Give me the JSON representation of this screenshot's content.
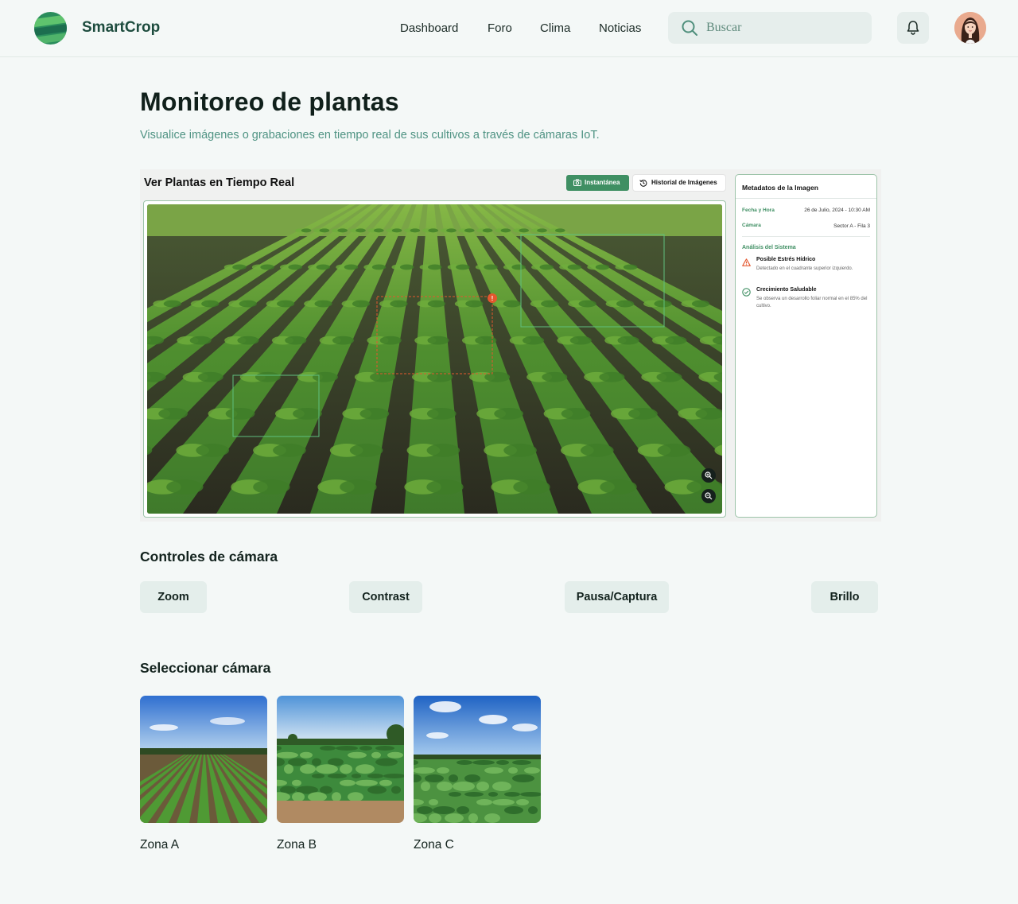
{
  "app": {
    "name": "SmartCrop"
  },
  "nav": {
    "items": [
      {
        "label": "Dashboard"
      },
      {
        "label": "Foro"
      },
      {
        "label": "Clima"
      },
      {
        "label": "Noticias"
      }
    ]
  },
  "search": {
    "placeholder": "Buscar"
  },
  "page": {
    "title": "Monitoreo de plantas",
    "subtitle": "Visualice imágenes o grabaciones en tiempo real de sus cultivos a través de cámaras IoT."
  },
  "monitor": {
    "title": "Ver Plantas en Tiempo Real",
    "snapshot_label": "Instantánea",
    "history_label": "Historial de Imágenes",
    "marker_label": "!"
  },
  "metadata": {
    "title": "Metadatos de la Imagen",
    "fields": [
      {
        "key": "Fecha y Hora",
        "value": "26 de Julio, 2024 - 10:30 AM"
      },
      {
        "key": "Cámara",
        "value": "Sector A - Fila 3"
      }
    ],
    "analysis_title": "Análisis del Sistema",
    "alerts": [
      {
        "title": "Posible Estrés Hídrico",
        "detail": "Detectado en el cuadrante superior izquierdo.",
        "icon": "warning-icon",
        "color": "#e4572e"
      },
      {
        "title": "Crecimiento Saludable",
        "detail": "Se observa un desarrollo foliar normal en el 85% del cultivo.",
        "icon": "check-circle-icon",
        "color": "#3f8f63"
      }
    ]
  },
  "controls": {
    "title": "Controles de cámara",
    "buttons": [
      {
        "label": "Zoom"
      },
      {
        "label": "Contrast"
      },
      {
        "label": "Pausa/Captura"
      },
      {
        "label": "Brillo"
      }
    ]
  },
  "cameras": {
    "title": "Seleccionar cámara",
    "items": [
      {
        "label": "Zona A"
      },
      {
        "label": "Zona B"
      },
      {
        "label": "Zona C"
      }
    ]
  },
  "colors": {
    "accent": "#3f8f63",
    "brand": "#1d4c3e",
    "subtitle": "#4f9383",
    "warning": "#e4572e"
  }
}
